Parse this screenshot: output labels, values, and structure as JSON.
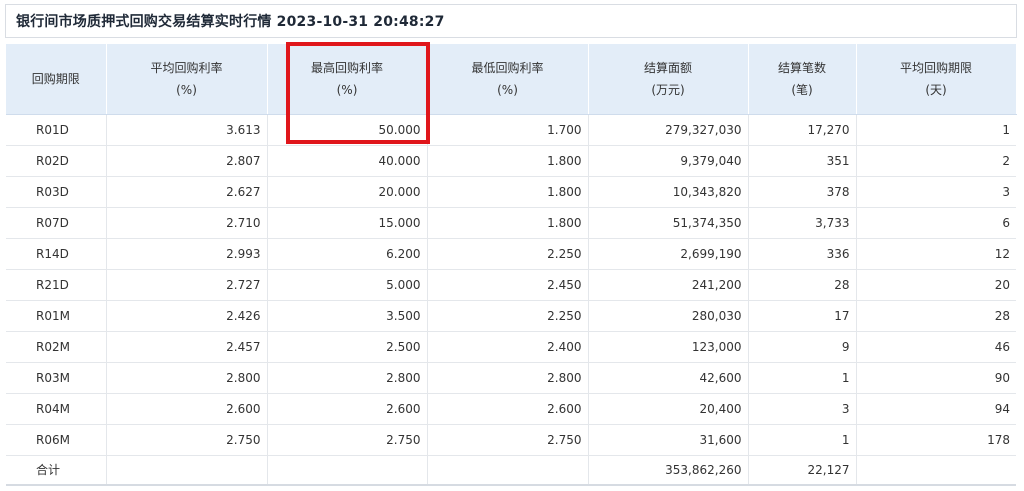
{
  "title": "银行间市场质押式回购交易结算实时行情 2023-10-31 20:48:27",
  "columns": [
    {
      "line1": "回购期限",
      "line2": ""
    },
    {
      "line1": "平均回购利率",
      "line2": "(%)"
    },
    {
      "line1": "最高回购利率",
      "line2": "(%)"
    },
    {
      "line1": "最低回购利率",
      "line2": "(%)"
    },
    {
      "line1": "结算面额",
      "line2": "(万元)"
    },
    {
      "line1": "结算笔数",
      "line2": "(笔)"
    },
    {
      "line1": "平均回购期限",
      "line2": "(天)"
    }
  ],
  "rows": [
    [
      "R01D",
      "3.613",
      "50.000",
      "1.700",
      "279,327,030",
      "17,270",
      "1"
    ],
    [
      "R02D",
      "2.807",
      "40.000",
      "1.800",
      "9,379,040",
      "351",
      "2"
    ],
    [
      "R03D",
      "2.627",
      "20.000",
      "1.800",
      "10,343,820",
      "378",
      "3"
    ],
    [
      "R07D",
      "2.710",
      "15.000",
      "1.800",
      "51,374,350",
      "3,733",
      "6"
    ],
    [
      "R14D",
      "2.993",
      "6.200",
      "2.250",
      "2,699,190",
      "336",
      "12"
    ],
    [
      "R21D",
      "2.727",
      "5.000",
      "2.450",
      "241,200",
      "28",
      "20"
    ],
    [
      "R01M",
      "2.426",
      "3.500",
      "2.250",
      "280,030",
      "17",
      "28"
    ],
    [
      "R02M",
      "2.457",
      "2.500",
      "2.400",
      "123,000",
      "9",
      "46"
    ],
    [
      "R03M",
      "2.800",
      "2.800",
      "2.800",
      "42,600",
      "1",
      "90"
    ],
    [
      "R04M",
      "2.600",
      "2.600",
      "2.600",
      "20,400",
      "3",
      "94"
    ],
    [
      "R06M",
      "2.750",
      "2.750",
      "2.750",
      "31,600",
      "1",
      "178"
    ]
  ],
  "total": [
    "合计",
    "",
    "",
    "",
    "353,862,260",
    "22,127",
    ""
  ],
  "colors": {
    "header_bg": "#e3edf8",
    "highlight": "#e0161b"
  }
}
